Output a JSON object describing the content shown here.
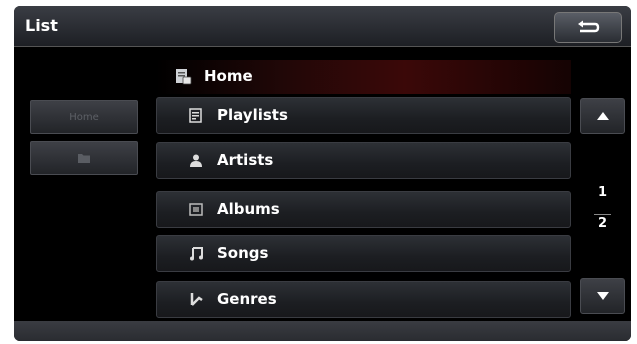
{
  "header": {
    "title": "List"
  },
  "current": {
    "label": "Home"
  },
  "side": {
    "home_label": "Home"
  },
  "items": [
    {
      "label": "Playlists",
      "icon": "playlist-icon"
    },
    {
      "label": "Artists",
      "icon": "artist-icon"
    },
    {
      "label": "Albums",
      "icon": "album-icon"
    },
    {
      "label": "Songs",
      "icon": "music-note-icon"
    },
    {
      "label": "Genres",
      "icon": "genre-icon"
    }
  ],
  "pager": {
    "current": "1",
    "total": "2"
  },
  "colors": {
    "accent": "#3b0808",
    "background": "#000000",
    "text": "#ffffff"
  }
}
